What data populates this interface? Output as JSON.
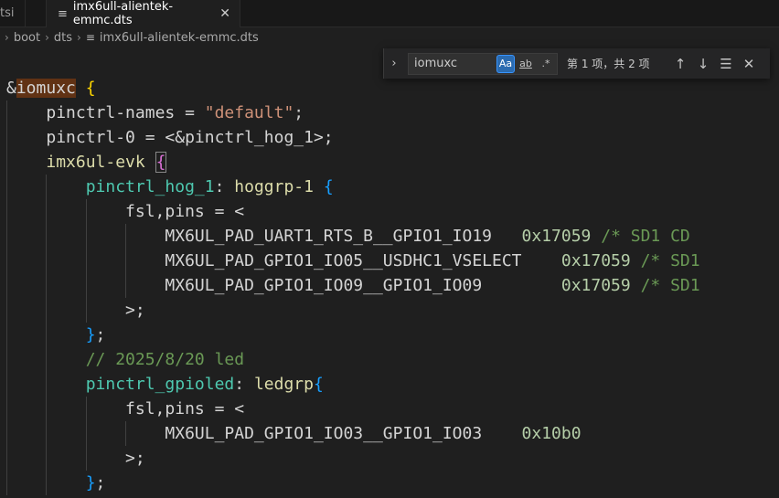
{
  "tabs": [
    {
      "label": "tsi",
      "active": false
    },
    {
      "label": "imx6ull-alientek-emmc.dts",
      "active": true,
      "icon": "lines-file-icon"
    }
  ],
  "breadcrumb": [
    "boot",
    "dts",
    "imx6ull-alientek-emmc.dts"
  ],
  "find": {
    "query": "iomuxc",
    "match_case_label": "Aa",
    "whole_word_label": "ab",
    "regex_label": ".*",
    "match_count": "第 1 项，共 2 项"
  },
  "code": {
    "l1": {
      "amp": "&",
      "ref": "iomuxc",
      "rest": " ",
      "brace": "{"
    },
    "l2": {
      "prop": "pinctrl-names = ",
      "str": "\"default\"",
      "end": ";"
    },
    "l3": {
      "text": "pinctrl-0 = <&pinctrl_hog_1>;"
    },
    "l4": {
      "node": "imx6ul-evk ",
      "brace": "{"
    },
    "l5": {
      "label": "pinctrl_hog_1",
      "colon": ": ",
      "node": "hoggrp-1 ",
      "brace": "{"
    },
    "l6": {
      "text": "fsl,pins = <"
    },
    "l7": {
      "macro": "MX6UL_PAD_UART1_RTS_B__GPIO1_IO19   ",
      "val": "0x17059",
      "comment": " /* SD1 CD"
    },
    "l8": {
      "macro": "MX6UL_PAD_GPIO1_IO05__USDHC1_VSELECT    ",
      "val": "0x17059",
      "comment": " /* SD1"
    },
    "l9": {
      "macro": "MX6UL_PAD_GPIO1_IO09__GPIO1_IO09        ",
      "val": "0x17059",
      "comment": " /* SD1"
    },
    "l10": {
      "text": ">;"
    },
    "l11": {
      "brace": "}",
      "end": ";"
    },
    "l12": {
      "comment": "// 2025/8/20 led"
    },
    "l13": {
      "label": "pinctrl_gpioled",
      "colon": ": ",
      "node": "ledgrp",
      "brace": "{"
    },
    "l14": {
      "text": "fsl,pins = <"
    },
    "l15": {
      "macro": "MX6UL_PAD_GPIO1_IO03__GPIO1_IO03    ",
      "val": "0x10b0"
    },
    "l16": {
      "text": ">;"
    },
    "l17": {
      "brace": "}",
      "end": ";"
    }
  }
}
